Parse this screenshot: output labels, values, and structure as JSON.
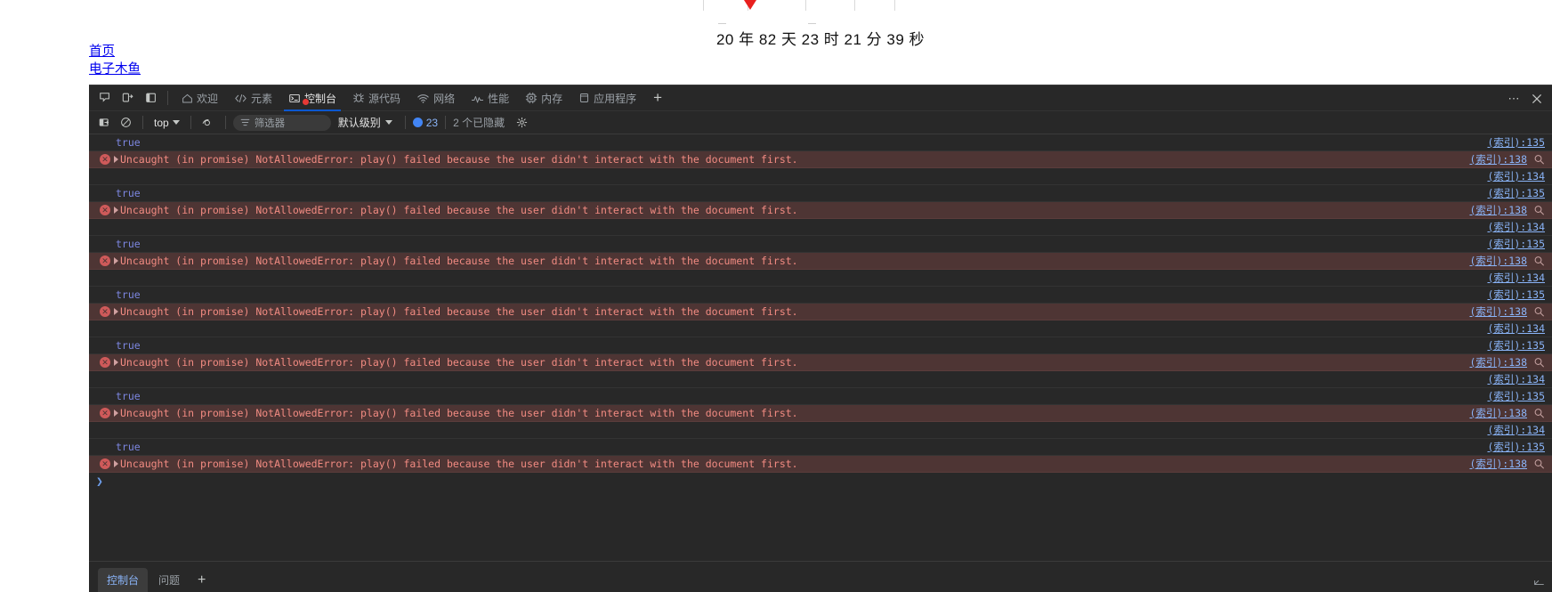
{
  "page": {
    "countdown": "20 年 82 天 23 时 21 分 39 秒",
    "links": [
      {
        "label": "首页"
      },
      {
        "label": "电子木鱼"
      }
    ]
  },
  "devtools": {
    "left_icons": [
      {
        "name": "inspect-element-icon"
      },
      {
        "name": "device-toolbar-icon"
      },
      {
        "name": "dock-side-icon"
      }
    ],
    "tabs": [
      {
        "label": "欢迎",
        "icon": "home-icon",
        "active": false
      },
      {
        "label": "元素",
        "icon": "code-brackets-icon",
        "active": false
      },
      {
        "label": "控制台",
        "icon": "console-icon",
        "active": true,
        "error_badge": true
      },
      {
        "label": "源代码",
        "icon": "bug-icon",
        "active": false
      },
      {
        "label": "网络",
        "icon": "wifi-icon",
        "active": false
      },
      {
        "label": "性能",
        "icon": "performance-icon",
        "active": false
      },
      {
        "label": "内存",
        "icon": "memory-chip-icon",
        "active": false
      },
      {
        "label": "应用程序",
        "icon": "application-icon",
        "active": false
      }
    ],
    "add_tab_label": "+",
    "more_label": "⋯",
    "filterbar": {
      "clear_console_title": "clear-console-icon",
      "no_entry_title": "no-entry-icon",
      "context": "top",
      "eye_icon": "live-expression-icon",
      "filter_placeholder": "筛选器",
      "filter_value": "",
      "levels_label": "默认级别",
      "issue_count": "23",
      "hidden_label": "2 个已隐藏",
      "settings_icon": "gear-icon"
    },
    "console": {
      "rows": [
        {
          "type": "value",
          "text": "true",
          "link": "(索引):135",
          "magnifier": false
        },
        {
          "type": "error",
          "text": "Uncaught (in promise) NotAllowedError: play() failed because the user didn't interact with the document first.",
          "link": "(索引):138",
          "magnifier": true
        },
        {
          "type": "linkonly",
          "text": "",
          "link": "(索引):134",
          "magnifier": false
        },
        {
          "type": "value",
          "text": "true",
          "link": "(索引):135",
          "magnifier": false
        },
        {
          "type": "error",
          "text": "Uncaught (in promise) NotAllowedError: play() failed because the user didn't interact with the document first.",
          "link": "(索引):138",
          "magnifier": true
        },
        {
          "type": "linkonly",
          "text": "",
          "link": "(索引):134",
          "magnifier": false
        },
        {
          "type": "value",
          "text": "true",
          "link": "(索引):135",
          "magnifier": false
        },
        {
          "type": "error",
          "text": "Uncaught (in promise) NotAllowedError: play() failed because the user didn't interact with the document first.",
          "link": "(索引):138",
          "magnifier": true
        },
        {
          "type": "linkonly",
          "text": "",
          "link": "(索引):134",
          "magnifier": false
        },
        {
          "type": "value",
          "text": "true",
          "link": "(索引):135",
          "magnifier": false
        },
        {
          "type": "error",
          "text": "Uncaught (in promise) NotAllowedError: play() failed because the user didn't interact with the document first.",
          "link": "(索引):138",
          "magnifier": true
        },
        {
          "type": "linkonly",
          "text": "",
          "link": "(索引):134",
          "magnifier": false
        },
        {
          "type": "value",
          "text": "true",
          "link": "(索引):135",
          "magnifier": false
        },
        {
          "type": "error",
          "text": "Uncaught (in promise) NotAllowedError: play() failed because the user didn't interact with the document first.",
          "link": "(索引):138",
          "magnifier": true
        },
        {
          "type": "linkonly",
          "text": "",
          "link": "(索引):134",
          "magnifier": false
        },
        {
          "type": "value",
          "text": "true",
          "link": "(索引):135",
          "magnifier": false
        },
        {
          "type": "error",
          "text": "Uncaught (in promise) NotAllowedError: play() failed because the user didn't interact with the document first.",
          "link": "(索引):138",
          "magnifier": true
        },
        {
          "type": "linkonly",
          "text": "",
          "link": "(索引):134",
          "magnifier": false
        },
        {
          "type": "value",
          "text": "true",
          "link": "(索引):135",
          "magnifier": false
        },
        {
          "type": "error",
          "text": "Uncaught (in promise) NotAllowedError: play() failed because the user didn't interact with the document first.",
          "link": "(索引):138",
          "magnifier": true
        }
      ],
      "prompt": "❯"
    },
    "drawer": {
      "tabs": [
        {
          "label": "控制台",
          "active": true
        },
        {
          "label": "问题",
          "active": false
        }
      ],
      "add_label": "+",
      "resize_icon": "drawer-resize-icon"
    }
  },
  "colors": {
    "accent_blue": "#0b57d0",
    "link_blue": "#8ab4f8",
    "error_red": "#f28b82",
    "error_bg": "#4e3534",
    "bg": "#282828",
    "page_link": "#0000ee",
    "heart_red": "#e8201e"
  }
}
